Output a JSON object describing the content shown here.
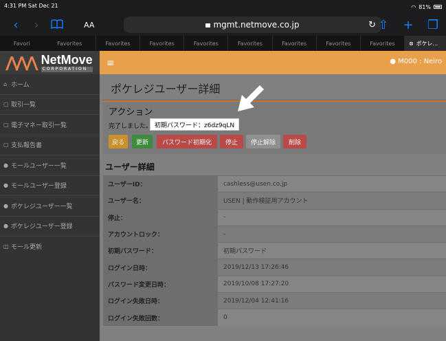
{
  "status": {
    "time": "4:31 PM  Sat Dec 21",
    "battery": "81%"
  },
  "toolbar": {
    "text_size": "AA",
    "url": "mgmt.netmove.co.jp"
  },
  "tabs": {
    "first_a": "Favori",
    "first_b": "Favorites",
    "items": [
      "Favorites",
      "Favorites",
      "Favorites",
      "Favorites",
      "Favorites",
      "Favorites",
      "Favorites"
    ],
    "active": "ポケレ..."
  },
  "brand": {
    "name": "NetMove",
    "sub": "CORPORATION"
  },
  "navbar": {
    "user": "M000 : Neiro"
  },
  "sidebar": {
    "items": [
      {
        "icon": "home-icon",
        "glyph": "⌂",
        "label": "ホーム"
      },
      {
        "icon": "document-icon",
        "glyph": "▢",
        "label": "取引一覧"
      },
      {
        "icon": "document-icon",
        "glyph": "▢",
        "label": "電子マネー取引一覧"
      },
      {
        "icon": "document-icon",
        "glyph": "▢",
        "label": "支払報告書"
      },
      {
        "icon": "user-icon",
        "glyph": "●",
        "label": "モールユーザー一覧"
      },
      {
        "icon": "user-icon",
        "glyph": "●",
        "label": "モールユーザー登録"
      },
      {
        "icon": "users-icon",
        "glyph": "●",
        "label": "ポケレジユーザー一覧"
      },
      {
        "icon": "users-icon",
        "glyph": "●",
        "label": "ポケレジユーザー登録"
      },
      {
        "icon": "cart-icon",
        "glyph": "◫",
        "label": "モール更新"
      }
    ]
  },
  "page": {
    "title": "ポケレジユーザー詳細"
  },
  "action": {
    "title": "アクション",
    "message": "完了しました。",
    "password_label": "初期パスワード：z6dz9qLN",
    "buttons": [
      {
        "label": "戻る",
        "color": "#c9902e"
      },
      {
        "label": "更新",
        "color": "#3e8a3e"
      },
      {
        "label": "パスワード初期化",
        "color": "#b94a48"
      },
      {
        "label": "停止",
        "color": "#b94a48"
      },
      {
        "label": "停止解除",
        "color": "#8f8f8f"
      },
      {
        "label": "削除",
        "color": "#b94a48"
      }
    ]
  },
  "details": {
    "title": "ユーザー詳細",
    "rows": [
      {
        "key": "ユーザーID：",
        "value": "cashless@usen.co.jp"
      },
      {
        "key": "ユーザー名：",
        "value": "USEN | 動作検証用アカウント"
      },
      {
        "key": "停止：",
        "value": "-"
      },
      {
        "key": "アカウントロック：",
        "value": "-"
      },
      {
        "key": "初期パスワード：",
        "value": "初期パスワード"
      },
      {
        "key": "ログイン日時：",
        "value": "2019/12/13 17:26:46"
      },
      {
        "key": "パスワード変更日時：",
        "value": "2019/10/08 17:27:20"
      },
      {
        "key": "ログイン失敗日時：",
        "value": "2019/12/04 12:41:16"
      },
      {
        "key": "ログイン失敗回数：",
        "value": "0"
      }
    ]
  }
}
